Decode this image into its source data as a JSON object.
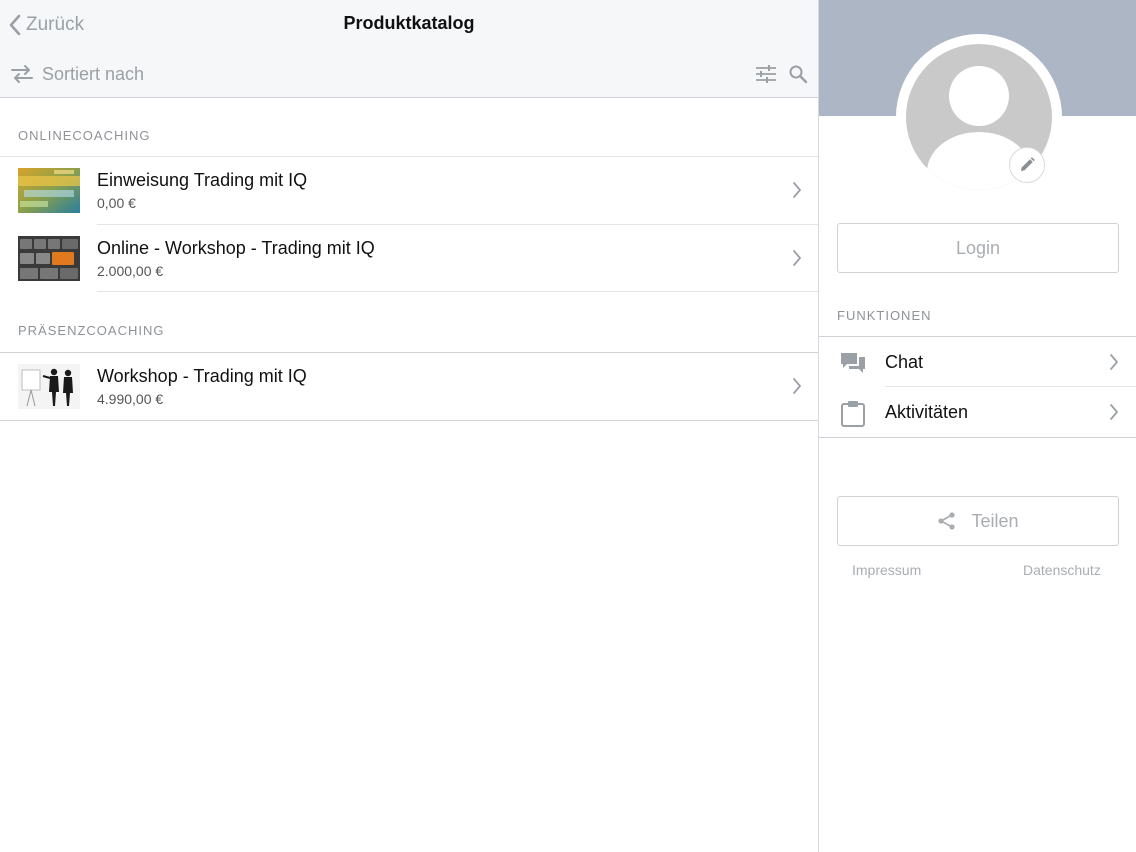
{
  "header": {
    "back_label": "Zurück",
    "title": "Produktkatalog",
    "sort_label": "Sortiert nach",
    "icons": [
      "swap-arrows-icon",
      "filter-sliders-icon",
      "search-icon"
    ]
  },
  "sections": [
    {
      "label": "ONLINECOACHING",
      "items": [
        {
          "name": "Einweisung Trading mit IQ",
          "price": "0,00 €",
          "thumb": "trading-word-cloud"
        },
        {
          "name": "Online - Workshop - Trading mit IQ",
          "price": "2.000,00 €",
          "thumb": "keyboard-orange-key"
        }
      ]
    },
    {
      "label": "PRÄSENZCOACHING",
      "items": [
        {
          "name": "Workshop - Trading mit IQ",
          "price": "4.990,00 €",
          "thumb": "presentation-silhouettes"
        }
      ]
    }
  ],
  "sidebar": {
    "login_label": "Login",
    "functions_label": "FUNKTIONEN",
    "functions": [
      {
        "label": "Chat",
        "icon": "chat-bubbles-icon"
      },
      {
        "label": "Aktivitäten",
        "icon": "clipboard-icon"
      }
    ],
    "share_label": "Teilen",
    "impressum": "Impressum",
    "datenschutz": "Datenschutz"
  },
  "colors": {
    "header_bg": "#f6f7f9",
    "cover_bg": "#adb6c4",
    "muted_text": "#9aa0a6",
    "divider": "#cfd2d6"
  }
}
